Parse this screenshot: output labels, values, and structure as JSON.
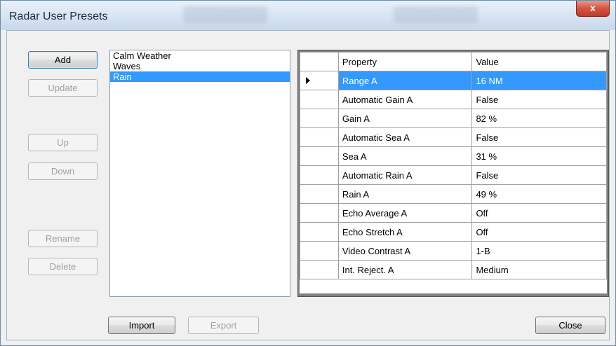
{
  "window": {
    "title": "Radar User Presets",
    "close_glyph": "x"
  },
  "buttons": {
    "add": "Add",
    "update": "Update",
    "up": "Up",
    "down": "Down",
    "rename": "Rename",
    "delete": "Delete",
    "import": "Import",
    "export": "Export",
    "close": "Close"
  },
  "presets": {
    "items": [
      "Calm Weather",
      "Waves",
      "Rain"
    ],
    "selected": "Rain"
  },
  "grid": {
    "headers": {
      "property": "Property",
      "value": "Value"
    },
    "rows": [
      {
        "property": "Range A",
        "value": "16 NM"
      },
      {
        "property": "Automatic Gain A",
        "value": "False"
      },
      {
        "property": "Gain A",
        "value": "82 %"
      },
      {
        "property": "Automatic Sea A",
        "value": "False"
      },
      {
        "property": "Sea A",
        "value": "31 %"
      },
      {
        "property": "Automatic Rain A",
        "value": "False"
      },
      {
        "property": "Rain A",
        "value": "49 %"
      },
      {
        "property": "Echo Average A",
        "value": "Off"
      },
      {
        "property": "Echo Stretch A",
        "value": "Off"
      },
      {
        "property": "Video Contrast A",
        "value": "1-B"
      },
      {
        "property": "Int. Reject. A",
        "value": "Medium"
      }
    ],
    "selected_row": 0
  },
  "colors": {
    "selection": "#3399ff",
    "close_button": "#c0392b"
  }
}
